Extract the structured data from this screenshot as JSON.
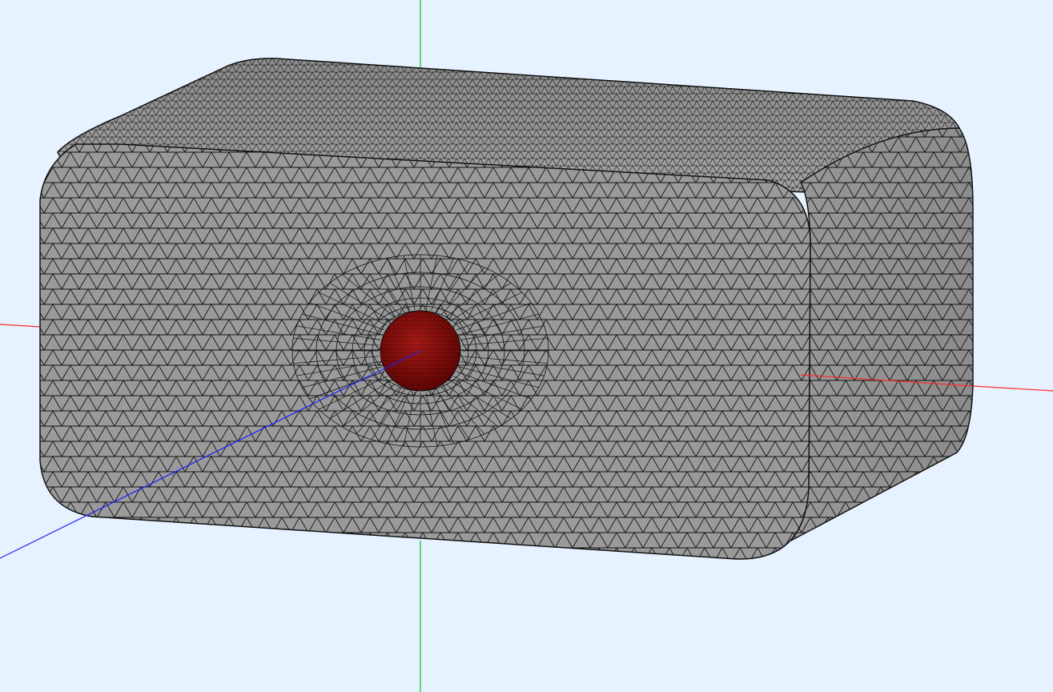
{
  "viewport": {
    "background": "#e6f2ff",
    "mesh_fill": "#989898",
    "mesh_edge": "#111111",
    "sphere_fill": "#8b0a0a",
    "axis_x_color": "#ff2a2a",
    "axis_y_color": "#16c41a",
    "axis_z_color": "#1e1eff"
  }
}
